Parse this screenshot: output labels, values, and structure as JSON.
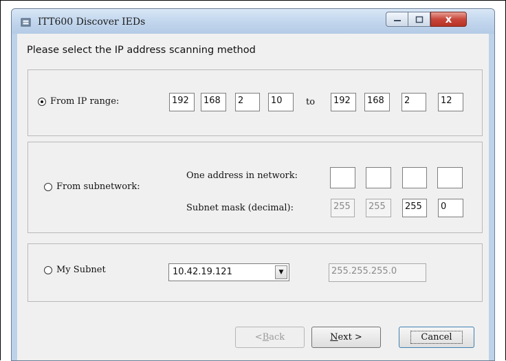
{
  "window": {
    "title": "ITT600 Discover IEDs",
    "close_glyph": "x"
  },
  "heading": "Please select the IP address scanning method",
  "ip_range": {
    "radio_label": "From IP range:",
    "selected": true,
    "from": [
      "192",
      "168",
      "2",
      "10"
    ],
    "to_label": "to",
    "to": [
      "192",
      "168",
      "2",
      "12"
    ]
  },
  "subnetwork": {
    "radio_label": "From subnetwork:",
    "selected": false,
    "address_label": "One address in network:",
    "address": [
      "",
      "",
      "",
      ""
    ],
    "mask_label": "Subnet mask (decimal):",
    "mask": [
      "255",
      "255",
      "255",
      "0"
    ]
  },
  "my_subnet": {
    "radio_label": "My Subnet",
    "selected": false,
    "combo_value": "10.42.19.121",
    "mask_value": "255.255.255.0"
  },
  "buttons": {
    "back": {
      "prefix": "< ",
      "accel": "B",
      "rest": "ack"
    },
    "next": {
      "accel": "N",
      "rest": "ext >"
    },
    "cancel": "Cancel"
  }
}
